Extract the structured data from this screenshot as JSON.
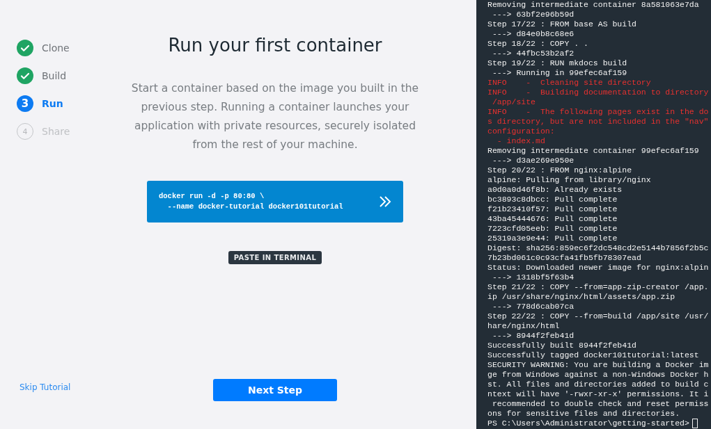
{
  "steps": [
    {
      "label": "Clone",
      "kind": "done"
    },
    {
      "label": "Build",
      "kind": "done"
    },
    {
      "label": "Run",
      "kind": "current",
      "number": "3"
    },
    {
      "label": "Share",
      "kind": "pending",
      "number": "4"
    }
  ],
  "title": "Run your first container",
  "description": "Start a container based on the image you built in the previous step. Running a container launches your application with private resources, securely isolated from the rest of your machine.",
  "command": {
    "lines": [
      "docker run -d -p 80:80 \\",
      "  --name docker-tutorial docker101tutorial"
    ]
  },
  "tooltip": "PASTE IN TERMINAL",
  "skip_link": "Skip Tutorial",
  "next_button": "Next Step",
  "terminal": {
    "lines": [
      {
        "kind": "out",
        "text": "Removing intermediate container 8a581063e7da"
      },
      {
        "kind": "out",
        "text": " ---> 63bf2e96b59d"
      },
      {
        "kind": "out",
        "text": "Step 17/22 : FROM base AS build"
      },
      {
        "kind": "out",
        "text": " ---> d84e0b8c68e6"
      },
      {
        "kind": "out",
        "text": "Step 18/22 : COPY . ."
      },
      {
        "kind": "out",
        "text": " ---> 44fbc53b2af2"
      },
      {
        "kind": "out",
        "text": "Step 19/22 : RUN mkdocs build"
      },
      {
        "kind": "out",
        "text": " ---> Running in 99efec6af159"
      },
      {
        "kind": "error",
        "text": "INFO    -  Cleaning site directory"
      },
      {
        "kind": "error",
        "text": "INFO    -  Building documentation to directory"
      },
      {
        "kind": "error",
        "text": " /app/site"
      },
      {
        "kind": "error",
        "text": "INFO    -  The following pages exist in the do"
      },
      {
        "kind": "error",
        "text": "s directory, but are not included in the \"nav\""
      },
      {
        "kind": "error",
        "text": "configuration:"
      },
      {
        "kind": "error",
        "text": "  - index.md"
      },
      {
        "kind": "out",
        "text": "Removing intermediate container 99efec6af159"
      },
      {
        "kind": "out",
        "text": " ---> d3ae269e950e"
      },
      {
        "kind": "out",
        "text": "Step 20/22 : FROM nginx:alpine"
      },
      {
        "kind": "out",
        "text": "alpine: Pulling from library/nginx"
      },
      {
        "kind": "out",
        "text": "a0d0a0d46f8b: Already exists"
      },
      {
        "kind": "out",
        "text": "bc3893c8dbcc: Pull complete"
      },
      {
        "kind": "out",
        "text": "f21b23410f57: Pull complete"
      },
      {
        "kind": "out",
        "text": "43ba45444676: Pull complete"
      },
      {
        "kind": "out",
        "text": "7223cfd05eeb: Pull complete"
      },
      {
        "kind": "out",
        "text": "25319a3e9e44: Pull complete"
      },
      {
        "kind": "out",
        "text": "Digest: sha256:859ec6f2dc548cd2e5144b7856f2b5c"
      },
      {
        "kind": "out",
        "text": "7b23bd061c0c93cfa41fb5fb78307ead"
      },
      {
        "kind": "out",
        "text": "Status: Downloaded newer image for nginx:alpin"
      },
      {
        "kind": "out",
        "text": " ---> 1318bf5f63b4"
      },
      {
        "kind": "out",
        "text": "Step 21/22 : COPY --from=app-zip-creator /app."
      },
      {
        "kind": "out",
        "text": "ip /usr/share/nginx/html/assets/app.zip"
      },
      {
        "kind": "out",
        "text": " ---> 778d6cab07ca"
      },
      {
        "kind": "out",
        "text": "Step 22/22 : COPY --from=build /app/site /usr/"
      },
      {
        "kind": "out",
        "text": "hare/nginx/html"
      },
      {
        "kind": "out",
        "text": " ---> 8944f2feb41d"
      },
      {
        "kind": "out",
        "text": "Successfully built 8944f2feb41d"
      },
      {
        "kind": "out",
        "text": "Successfully tagged docker101tutorial:latest"
      },
      {
        "kind": "out",
        "text": "SECURITY WARNING: You are building a Docker im"
      },
      {
        "kind": "out",
        "text": "ge from Windows against a non-Windows Docker h"
      },
      {
        "kind": "out",
        "text": "st. All files and directories added to build c"
      },
      {
        "kind": "out",
        "text": "ntext will have '-rwxr-xr-x' permissions. It i"
      },
      {
        "kind": "out",
        "text": " recommended to double check and reset permiss"
      },
      {
        "kind": "out",
        "text": "ons for sensitive files and directories."
      },
      {
        "kind": "prompt",
        "text": "PS C:\\Users\\Administrator\\getting-started>"
      }
    ]
  }
}
